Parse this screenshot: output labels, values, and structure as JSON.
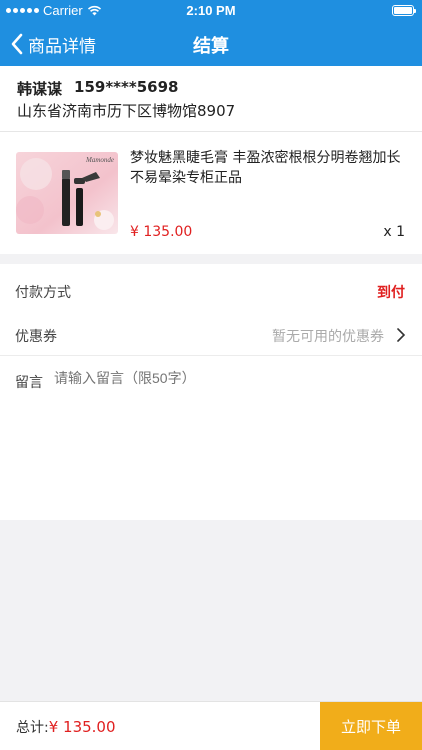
{
  "status_bar": {
    "carrier": "Carrier",
    "time": "2:10 PM"
  },
  "nav": {
    "back_label": "商品详情",
    "title": "结算"
  },
  "address": {
    "name": "韩谋谋",
    "phone": "159****5698",
    "address": "山东省济南市历下区博物馆8907"
  },
  "product": {
    "brand_text": "Mamonde",
    "name": "梦妆魅黑睫毛膏 丰盈浓密根根分明卷翘加长不易晕染专柜正品",
    "price": "¥ 135.00",
    "quantity": "x 1"
  },
  "payment": {
    "label": "付款方式",
    "value": "到付"
  },
  "coupon": {
    "label": "优惠券",
    "value": "暂无可用的优惠券"
  },
  "message": {
    "label": "留言",
    "placeholder": "请输入留言（限50字）"
  },
  "footer": {
    "total_label": "总计:",
    "total_value": "¥ 135.00",
    "order_button": "立即下单"
  },
  "colors": {
    "nav_blue": "#1f8fe0",
    "accent_red": "#e02020",
    "order_button": "#f1ad1a"
  },
  "icons": [
    "wifi-icon",
    "battery-icon",
    "back-chevron-icon",
    "chevron-right-icon"
  ]
}
